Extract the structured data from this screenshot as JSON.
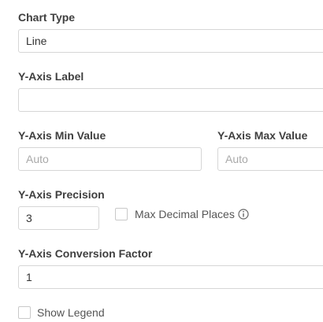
{
  "chart_type": {
    "label": "Chart Type",
    "value": "Line"
  },
  "y_axis_label": {
    "label": "Y-Axis Label",
    "value": ""
  },
  "y_axis_min": {
    "label": "Y-Axis Min Value",
    "placeholder": "Auto",
    "value": ""
  },
  "y_axis_max": {
    "label": "Y-Axis Max Value",
    "placeholder": "Auto",
    "value": ""
  },
  "y_axis_precision": {
    "label": "Y-Axis Precision",
    "value": "3"
  },
  "max_decimal_places": {
    "label": "Max Decimal Places",
    "checked": false,
    "icon": "info-icon"
  },
  "y_axis_conversion_factor": {
    "label": "Y-Axis Conversion Factor",
    "value": "1"
  },
  "show_legend": {
    "label": "Show Legend",
    "checked": false
  }
}
